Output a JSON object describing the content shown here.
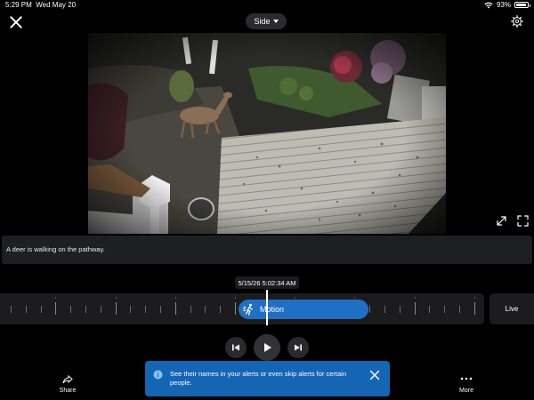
{
  "status_bar": {
    "time": "5:29 PM",
    "date": "Wed May 20",
    "battery": "93%"
  },
  "header": {
    "camera_name": "Side"
  },
  "event": {
    "caption": "A deer is walking on the pathway.",
    "timestamp": "5/15/26 5:02:34 AM",
    "motion_label": "Motion",
    "live_label": "Live"
  },
  "actions": {
    "share_label": "Share",
    "more_label": "More"
  },
  "toast": {
    "message": "See their names in your alerts or even skip alerts for certain people."
  },
  "colors": {
    "accent": "#1f6fc4",
    "toast_bg": "#1565b5",
    "panel": "#1c1c1e"
  },
  "icons": {
    "close": "close-icon",
    "chevron": "chevron-down-icon",
    "settings": "gear-icon",
    "resize": "resize-icon",
    "fullscreen": "fullscreen-icon",
    "motion": "motion-icon",
    "prev": "skip-previous-icon",
    "play": "play-icon",
    "next": "skip-next-icon",
    "share": "share-icon",
    "more": "more-icon",
    "info": "info-icon"
  }
}
